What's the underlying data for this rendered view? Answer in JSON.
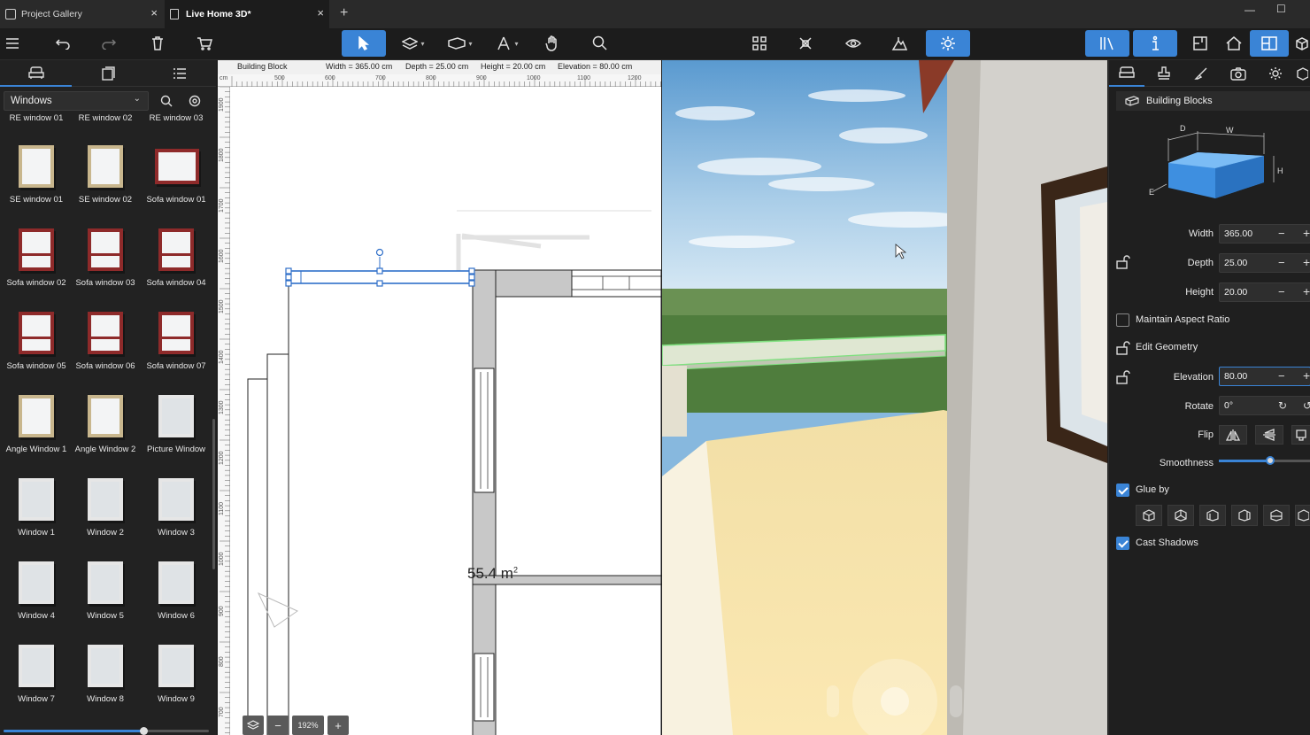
{
  "tabs": [
    {
      "label": "Project Gallery"
    },
    {
      "label": "Live Home 3D*"
    }
  ],
  "library": {
    "category": "Windows",
    "top_row_labels": [
      "RE window 01",
      "RE window 02",
      "RE window 03"
    ],
    "items": [
      {
        "label": "SE window 01",
        "style": "wood"
      },
      {
        "label": "SE window 02",
        "style": "wood"
      },
      {
        "label": "Sofa window 01",
        "style": "red-wide"
      },
      {
        "label": "Sofa window 02",
        "style": "red"
      },
      {
        "label": "Sofa window 03",
        "style": "red"
      },
      {
        "label": "Sofa window 04",
        "style": "red"
      },
      {
        "label": "Sofa window 05",
        "style": "red"
      },
      {
        "label": "Sofa window 06",
        "style": "red"
      },
      {
        "label": "Sofa window 07",
        "style": "red"
      },
      {
        "label": "Angle Window 1",
        "style": "wood"
      },
      {
        "label": "Angle Window 2",
        "style": "wood"
      },
      {
        "label": "Picture Window",
        "style": "white"
      },
      {
        "label": "Window 1",
        "style": "white"
      },
      {
        "label": "Window 2",
        "style": "white"
      },
      {
        "label": "Window 3",
        "style": "white"
      },
      {
        "label": "Window 4",
        "style": "white"
      },
      {
        "label": "Window 5",
        "style": "white"
      },
      {
        "label": "Window 6",
        "style": "white"
      },
      {
        "label": "Window 7",
        "style": "white"
      },
      {
        "label": "Window 8",
        "style": "white"
      },
      {
        "label": "Window 9",
        "style": "white"
      }
    ]
  },
  "plan": {
    "object": "Building Block",
    "width": "Width = 365.00 cm",
    "depth": "Depth = 25.00 cm",
    "height": "Height = 20.00 cm",
    "elevation": "Elevation = 80.00 cm",
    "ruler_unit": "cm",
    "ruler_h": [
      "500",
      "600",
      "700",
      "800",
      "900",
      "1000",
      "1100",
      "1200"
    ],
    "ruler_v": [
      "1900",
      "1800",
      "1700",
      "1600",
      "1500",
      "1400",
      "1300",
      "1200",
      "1100",
      "1000",
      "900",
      "800",
      "700"
    ],
    "area_value": "55.4 m",
    "area_sup": "2",
    "zoom": "192%"
  },
  "properties": {
    "header": "Building Blocks",
    "diagram": {
      "d": "D",
      "w": "W",
      "h": "H",
      "e": "E"
    },
    "width_label": "Width",
    "width_value": "365.00",
    "depth_label": "Depth",
    "depth_value": "25.00",
    "height_label": "Height",
    "height_value": "20.00",
    "maintain_aspect": "Maintain Aspect Ratio",
    "edit_geometry": "Edit Geometry",
    "elevation_label": "Elevation",
    "elevation_value": "80.00",
    "rotate_label": "Rotate",
    "rotate_value": "0°",
    "flip_label": "Flip",
    "smoothness_label": "Smoothness",
    "glue_by": "Glue by",
    "cast_shadows": "Cast Shadows"
  },
  "colors": {
    "accent": "#3a84d6",
    "wall_gray": "#c8c8c8",
    "selection": "#2f6fc9"
  }
}
